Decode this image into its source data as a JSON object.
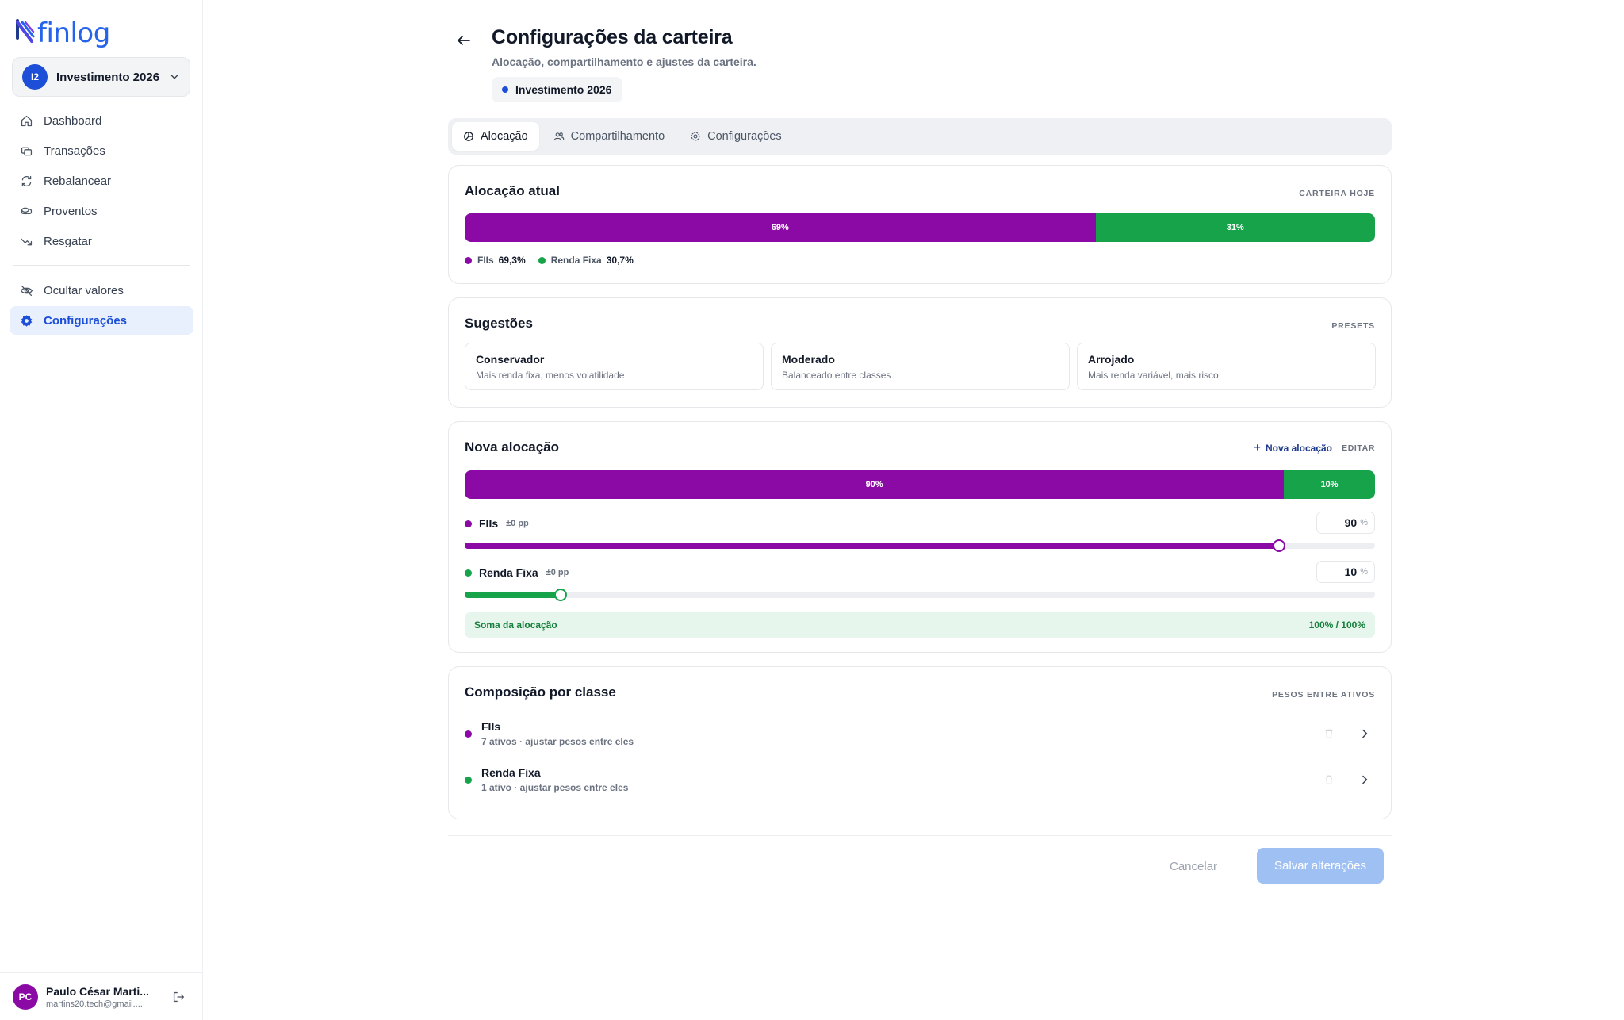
{
  "brand": {
    "name": "finlog",
    "color": "#2563eb"
  },
  "wallet_switcher": {
    "initials": "I2",
    "name": "Investimento 2026"
  },
  "nav": {
    "items": [
      {
        "label": "Dashboard",
        "icon": "home-icon"
      },
      {
        "label": "Transações",
        "icon": "transactions-icon"
      },
      {
        "label": "Rebalancear",
        "icon": "refresh-icon"
      },
      {
        "label": "Proventos",
        "icon": "coins-icon"
      },
      {
        "label": "Resgatar",
        "icon": "trending-down-icon"
      }
    ],
    "secondary": [
      {
        "label": "Ocultar valores",
        "icon": "eye-off-icon"
      },
      {
        "label": "Configurações",
        "icon": "gear-icon",
        "active": true
      }
    ]
  },
  "user": {
    "initials": "PC",
    "name": "Paulo César Marti...",
    "email": "martins20.tech@gmail...."
  },
  "header": {
    "title": "Configurações da carteira",
    "subtitle": "Alocação, compartilhamento e ajustes da carteira.",
    "wallet_chip": "Investimento 2026"
  },
  "tabs": [
    {
      "label": "Alocação",
      "icon": "pie-chart-icon",
      "active": true
    },
    {
      "label": "Compartilhamento",
      "icon": "users-icon",
      "active": false
    },
    {
      "label": "Configurações",
      "icon": "gear-icon",
      "active": false
    }
  ],
  "current_allocation": {
    "title": "Alocação atual",
    "tag": "CARTEIRA HOJE",
    "segments": [
      {
        "label": "69%",
        "share": 69.3,
        "color": "#8b0aa5"
      },
      {
        "label": "31%",
        "share": 30.7,
        "color": "#16a34a"
      }
    ],
    "legend": [
      {
        "name": "FIIs",
        "value": "69,3%",
        "color": "#8b0aa5"
      },
      {
        "name": "Renda Fixa",
        "value": "30,7%",
        "color": "#16a34a"
      }
    ]
  },
  "suggestions": {
    "title": "Sugestões",
    "tag": "PRESETS",
    "presets": [
      {
        "name": "Conservador",
        "desc": "Mais renda fixa, menos volatilidade"
      },
      {
        "name": "Moderado",
        "desc": "Balanceado entre classes"
      },
      {
        "name": "Arrojado",
        "desc": "Mais renda variável, mais risco"
      }
    ]
  },
  "new_allocation": {
    "title": "Nova alocação",
    "add_label": "Nova alocação",
    "edit_label": "EDITAR",
    "segments": [
      {
        "label": "90%",
        "share": 90,
        "color": "#8b0aa5"
      },
      {
        "label": "10%",
        "share": 10,
        "color": "#16a34a"
      }
    ],
    "classes": [
      {
        "name": "FIIs",
        "delta": "±0 pp",
        "value": "90",
        "unit": "%",
        "color": "#8b0aa5",
        "slider_pct": 89.5
      },
      {
        "name": "Renda Fixa",
        "delta": "±0 pp",
        "value": "10",
        "unit": "%",
        "color": "#16a34a",
        "slider_pct": 10.5
      }
    ],
    "sum_label": "Soma da alocação",
    "sum_value": "100% / 100%"
  },
  "composition": {
    "title": "Composição por classe",
    "tag": "PESOS ENTRE ATIVOS",
    "rows": [
      {
        "name": "FIIs",
        "sub": "7 ativos · ajustar pesos entre eles",
        "color": "#8b0aa5"
      },
      {
        "name": "Renda Fixa",
        "sub": "1 ativo · ajustar pesos entre eles",
        "color": "#16a34a"
      }
    ]
  },
  "actions": {
    "cancel": "Cancelar",
    "save": "Salvar alterações"
  }
}
